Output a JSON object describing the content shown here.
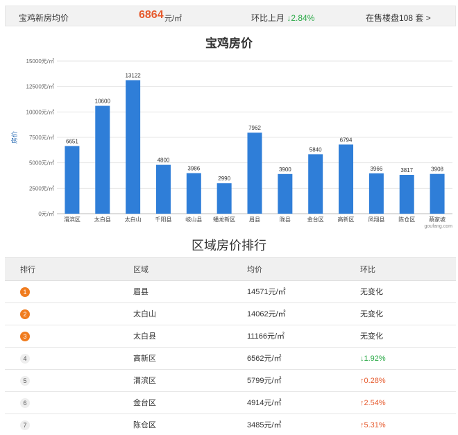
{
  "topbar": {
    "city_label": "宝鸡新房均价",
    "price": "6864",
    "unit": "元/㎡",
    "mom_label": "环比上月",
    "mom_value": "↓2.84%",
    "onsale": "在售楼盘108 套 >"
  },
  "colors": {
    "bar": "#2f7ed8",
    "accent": "#e65a2d",
    "down": "#27a844",
    "rank_badge": "#f07c1f"
  },
  "chart_data": {
    "type": "bar",
    "title": "宝鸡房价",
    "ylabel": "房价",
    "xlabel": "",
    "watermark": "goufang.com",
    "ylim": [
      0,
      15000
    ],
    "yticks": [
      0,
      2500,
      5000,
      7500,
      10000,
      12500,
      15000
    ],
    "ytick_labels": [
      "0元/㎡",
      "2500元/㎡",
      "5000元/㎡",
      "7500元/㎡",
      "10000元/㎡",
      "12500元/㎡",
      "15000元/㎡"
    ],
    "categories": [
      "渭滨区",
      "太白县",
      "太白山",
      "千阳县",
      "岐山县",
      "蟠龙新区",
      "眉县",
      "陇县",
      "金台区",
      "高新区",
      "凤翔县",
      "陈仓区",
      "蔡家坡"
    ],
    "values": [
      6651,
      10600,
      13122,
      4800,
      3986,
      2990,
      7962,
      3900,
      5840,
      6794,
      3966,
      3817,
      3908
    ],
    "grid": true,
    "legend": "none"
  },
  "ranking": {
    "title": "区域房价排行",
    "headers": [
      "排行",
      "区域",
      "均价",
      "环比"
    ],
    "rows": [
      {
        "rank": "1",
        "area": "眉县",
        "price": "14571元/㎡",
        "change": "无变化",
        "trend": "none"
      },
      {
        "rank": "2",
        "area": "太白山",
        "price": "14062元/㎡",
        "change": "无变化",
        "trend": "none"
      },
      {
        "rank": "3",
        "area": "太白县",
        "price": "11166元/㎡",
        "change": "无变化",
        "trend": "none"
      },
      {
        "rank": "4",
        "area": "高新区",
        "price": "6562元/㎡",
        "change": "↓1.92%",
        "trend": "down"
      },
      {
        "rank": "5",
        "area": "渭滨区",
        "price": "5799元/㎡",
        "change": "↑0.28%",
        "trend": "up"
      },
      {
        "rank": "6",
        "area": "金台区",
        "price": "4914元/㎡",
        "change": "↑2.54%",
        "trend": "up"
      },
      {
        "rank": "7",
        "area": "陈仓区",
        "price": "3485元/㎡",
        "change": "↑5.31%",
        "trend": "up"
      }
    ]
  }
}
